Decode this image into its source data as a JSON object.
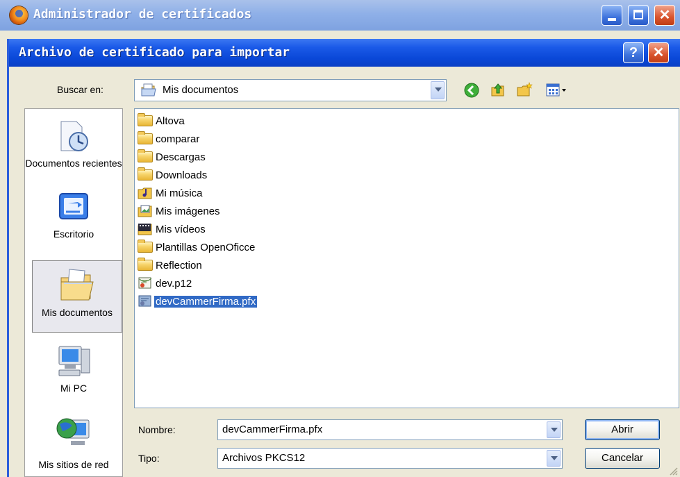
{
  "outer_window": {
    "title": "Administrador de certificados"
  },
  "dialog": {
    "title": "Archivo de certificado para importar",
    "help_glyph": "?",
    "close_glyph": "✕"
  },
  "lookin": {
    "label": "Buscar en:",
    "value": "Mis documentos"
  },
  "places": [
    {
      "label": "Documentos recientes",
      "icon": "recent-documents-icon"
    },
    {
      "label": "Escritorio",
      "icon": "desktop-icon"
    },
    {
      "label": "Mis documentos",
      "icon": "my-documents-icon",
      "selected": true
    },
    {
      "label": "Mi PC",
      "icon": "my-computer-icon"
    },
    {
      "label": "Mis sitios de red",
      "icon": "network-places-icon"
    }
  ],
  "files": [
    {
      "name": "Altova",
      "type": "folder"
    },
    {
      "name": "comparar",
      "type": "folder"
    },
    {
      "name": "Descargas",
      "type": "folder"
    },
    {
      "name": "Downloads",
      "type": "folder"
    },
    {
      "name": "Mi música",
      "type": "music-folder"
    },
    {
      "name": "Mis imágenes",
      "type": "pictures-folder"
    },
    {
      "name": "Mis vídeos",
      "type": "videos-folder"
    },
    {
      "name": "Plantillas OpenOficce",
      "type": "folder"
    },
    {
      "name": "Reflection",
      "type": "folder"
    },
    {
      "name": "dev.p12",
      "type": "certificate"
    },
    {
      "name": "devCammerFirma.pfx",
      "type": "certificate",
      "selected": true
    }
  ],
  "filename": {
    "label": "Nombre:",
    "value": "devCammerFirma.pfx"
  },
  "filetype": {
    "label": "Tipo:",
    "value": "Archivos PKCS12"
  },
  "buttons": {
    "open": "Abrir",
    "cancel": "Cancelar"
  },
  "colors": {
    "dialog_titlebar": "#0a48d8",
    "selection": "#316ac5",
    "face": "#ece9d8"
  }
}
